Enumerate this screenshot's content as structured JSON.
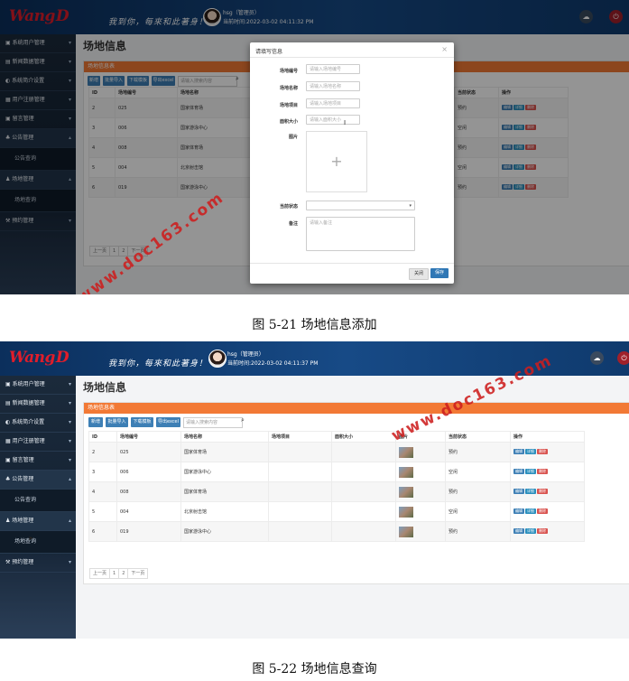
{
  "header": {
    "logo_text": "Wang",
    "logo_mark": "D",
    "slogan": "我到你，每來和此著身！",
    "user_name": "hsg（管理员）",
    "login_time_shot1": "当前时间:2022-03-02 04:11:32 PM",
    "login_time_shot2": "当前时间:2022-03-02 04:11:37 PM",
    "icons": [
      "cloud-icon",
      "power-icon"
    ]
  },
  "sidebar": {
    "items": [
      {
        "label": "系统用户管理"
      },
      {
        "label": "新闻数据管理"
      },
      {
        "label": "系统简介设置"
      },
      {
        "label": "用户注册管理"
      },
      {
        "label": "留言管理"
      },
      {
        "label": "公告管理"
      },
      {
        "label": "公告查询"
      },
      {
        "label": "场地管理"
      },
      {
        "label": "场地查询"
      },
      {
        "label": "预约管理"
      }
    ]
  },
  "page": {
    "title": "场地信息",
    "panel_title": "场地信息表",
    "toolbar": {
      "add": "新增",
      "batch_import": "批量导入",
      "download_template": "下载模板",
      "export_excel": "导出excel",
      "search_placeholder": "请输入搜索内容"
    },
    "columns": [
      "ID",
      "场地编号",
      "场地名称",
      "场地项目",
      "面积大小",
      "图片",
      "当前状态",
      "操作"
    ],
    "rows": [
      {
        "id": "2",
        "code": "025",
        "name": "国家体育场",
        "status": "预约"
      },
      {
        "id": "3",
        "code": "006",
        "name": "国家游泳中心",
        "status": "空闲"
      },
      {
        "id": "4",
        "code": "008",
        "name": "国家体育场",
        "status": "预约"
      },
      {
        "id": "5",
        "code": "004",
        "name": "北京射击馆",
        "status": "空闲"
      },
      {
        "id": "6",
        "code": "019",
        "name": "国家游泳中心",
        "status": "预约"
      }
    ],
    "row_actions": {
      "edit": "编辑",
      "detail": "详细",
      "delete": "删除"
    },
    "pager": {
      "prev": "上一页",
      "p1": "1",
      "p2": "2",
      "next": "下一页"
    }
  },
  "modal": {
    "title": "请填写信息",
    "close_icon": "×",
    "fields": [
      {
        "label": "场地编号",
        "placeholder": "请输入场地编号"
      },
      {
        "label": "场地名称",
        "placeholder": "请输入场地名称"
      },
      {
        "label": "场地项目",
        "placeholder": "请输入场地项目"
      },
      {
        "label": "面积大小",
        "placeholder": "请输入面积大小"
      },
      {
        "label": "图片"
      },
      {
        "label": "当前状态"
      },
      {
        "label": "备注",
        "placeholder": "请输入备注"
      }
    ],
    "upload_plus": "+",
    "close_button": "关闭",
    "save_button": "保存"
  },
  "captions": {
    "fig1": "图 5-21 场地信息添加",
    "fig2": "图 5-22 场地信息查询"
  },
  "watermark": "www.doc163.com"
}
